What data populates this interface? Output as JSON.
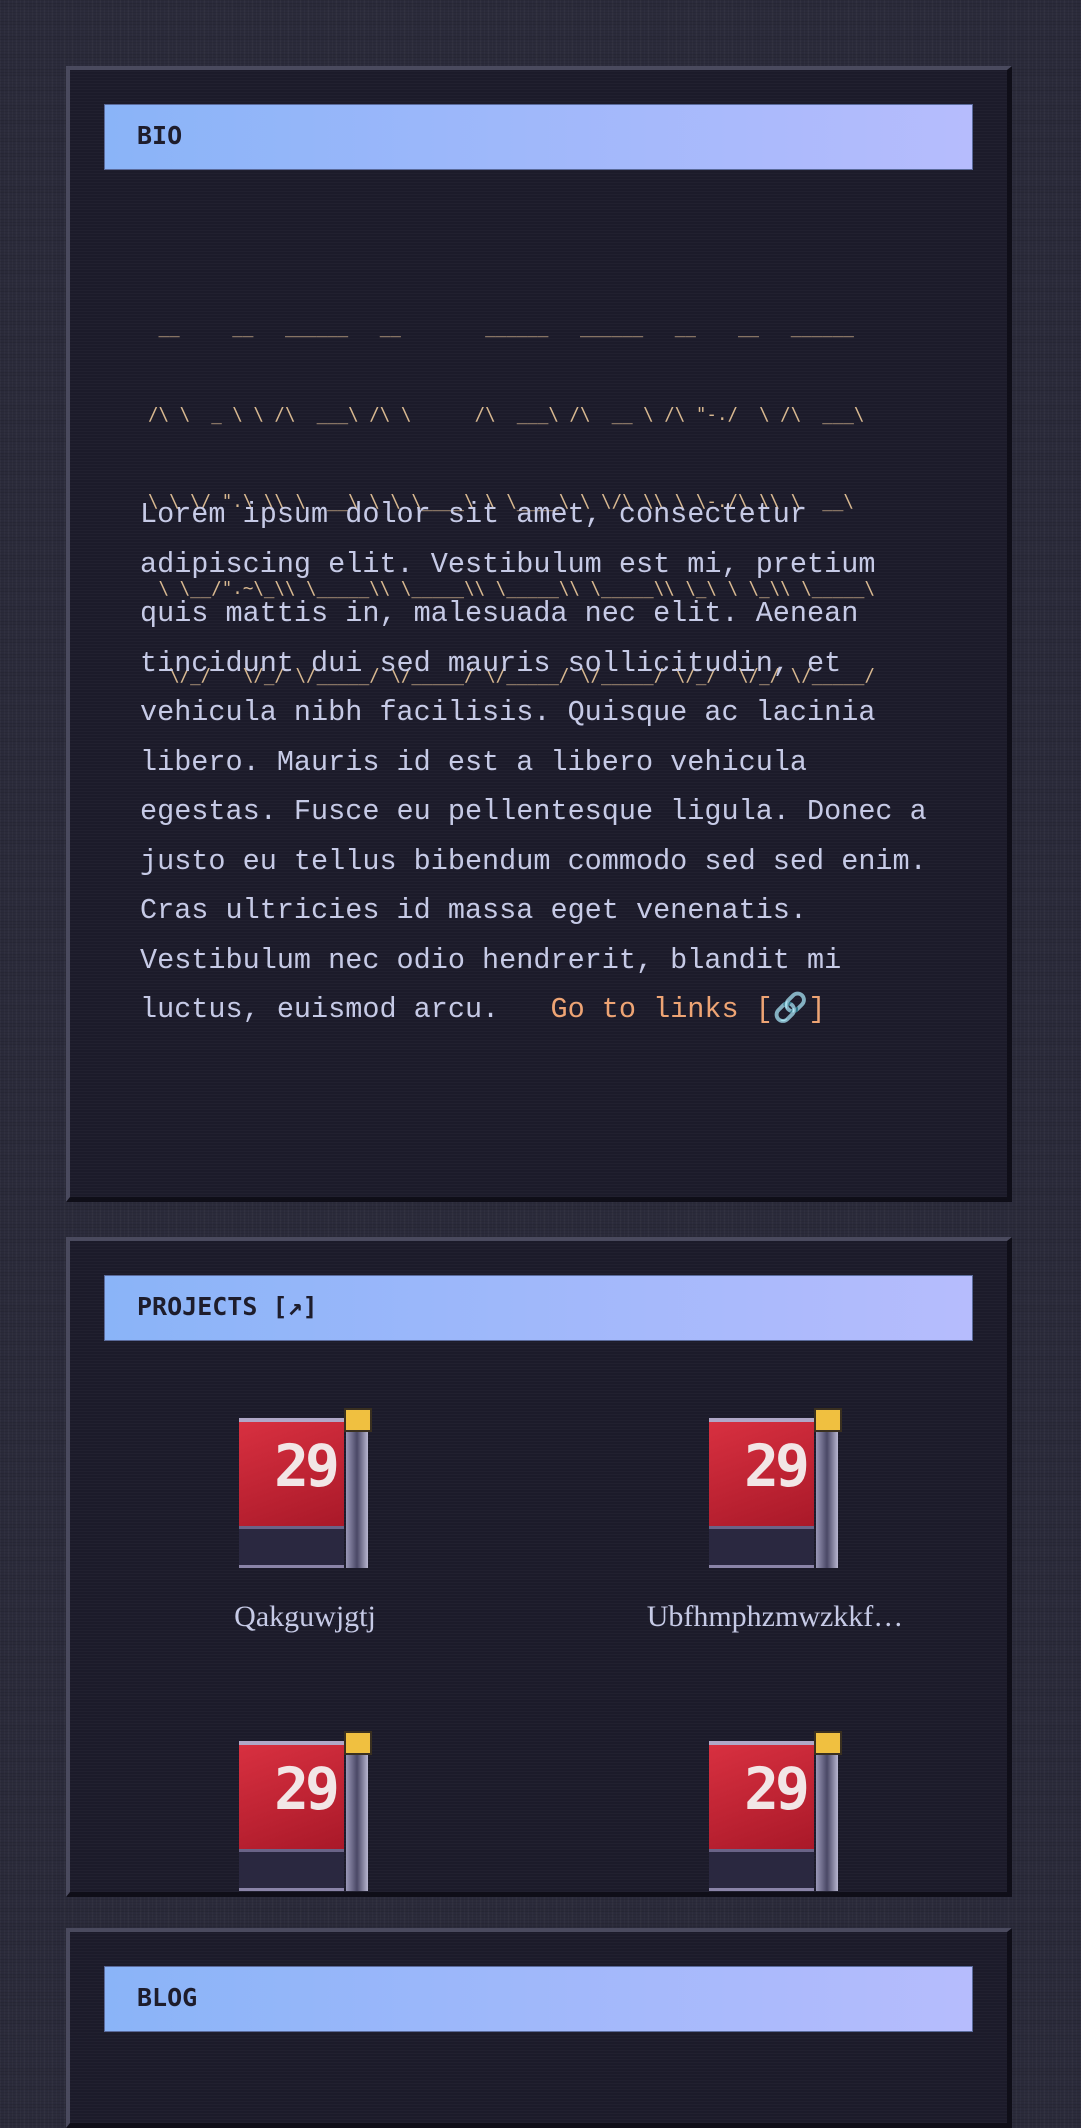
{
  "bio": {
    "title": "BIO",
    "ascii_art": [
      " __     __   ______   __        ______   ______   __    __   ______",
      "/\\ \\  _ \\ \\ /\\  ___\\ /\\ \\      /\\  ___\\ /\\  __ \\ /\\ \"-./  \\ /\\  ___\\",
      "\\ \\ \\/ \".\\ \\\\ \\  __\\ \\ \\ \\____\\ \\ \\____\\ \\ \\/\\ \\\\ \\ \\-./\\ \\\\ \\  __\\",
      " \\ \\__/\".~\\_\\\\ \\_____\\\\ \\_____\\\\ \\_____\\\\ \\_____\\\\ \\_\\ \\ \\_\\\\ \\_____\\",
      "  \\/_/   \\/_/ \\/_____/ \\/_____/ \\/_____/ \\/_____/ \\/_/  \\/_/ \\/_____/"
    ],
    "text": "Lorem ipsum dolor sit amet, consectetur adipiscing elit. Vestibulum est mi, pretium quis mattis in, malesuada nec elit. Aenean tincidunt dui sed mauris sollicitudin, et vehicula nibh facilisis. Quisque ac lacinia libero. Mauris id est a libero vehicula egestas. Fusce eu pellentesque ligula. Donec a justo eu tellus bibendum commodo sed sed enim. Cras ultricies id massa eget venenatis. Vestibulum nec odio hendrerit, blandit mi luctus, euismod arcu.",
    "link_label": "Go to links [",
    "link_icon": "🔗",
    "link_close": "]"
  },
  "projects": {
    "title": "PROJECTS [↗]",
    "items": [
      {
        "name": "Qakguwjgtj",
        "icon_label": "29"
      },
      {
        "name": "Ubfhmphzmwzkkf…",
        "icon_label": "29"
      },
      {
        "name": "",
        "icon_label": "29"
      },
      {
        "name": "",
        "icon_label": "29"
      }
    ]
  },
  "blog": {
    "title": "BLOG"
  },
  "colors": {
    "header_start": "#8ab4f8",
    "header_end": "#b6bcfd",
    "link": "#eea474",
    "ascii": "#d8b890",
    "panel": "#1c1b2a"
  }
}
